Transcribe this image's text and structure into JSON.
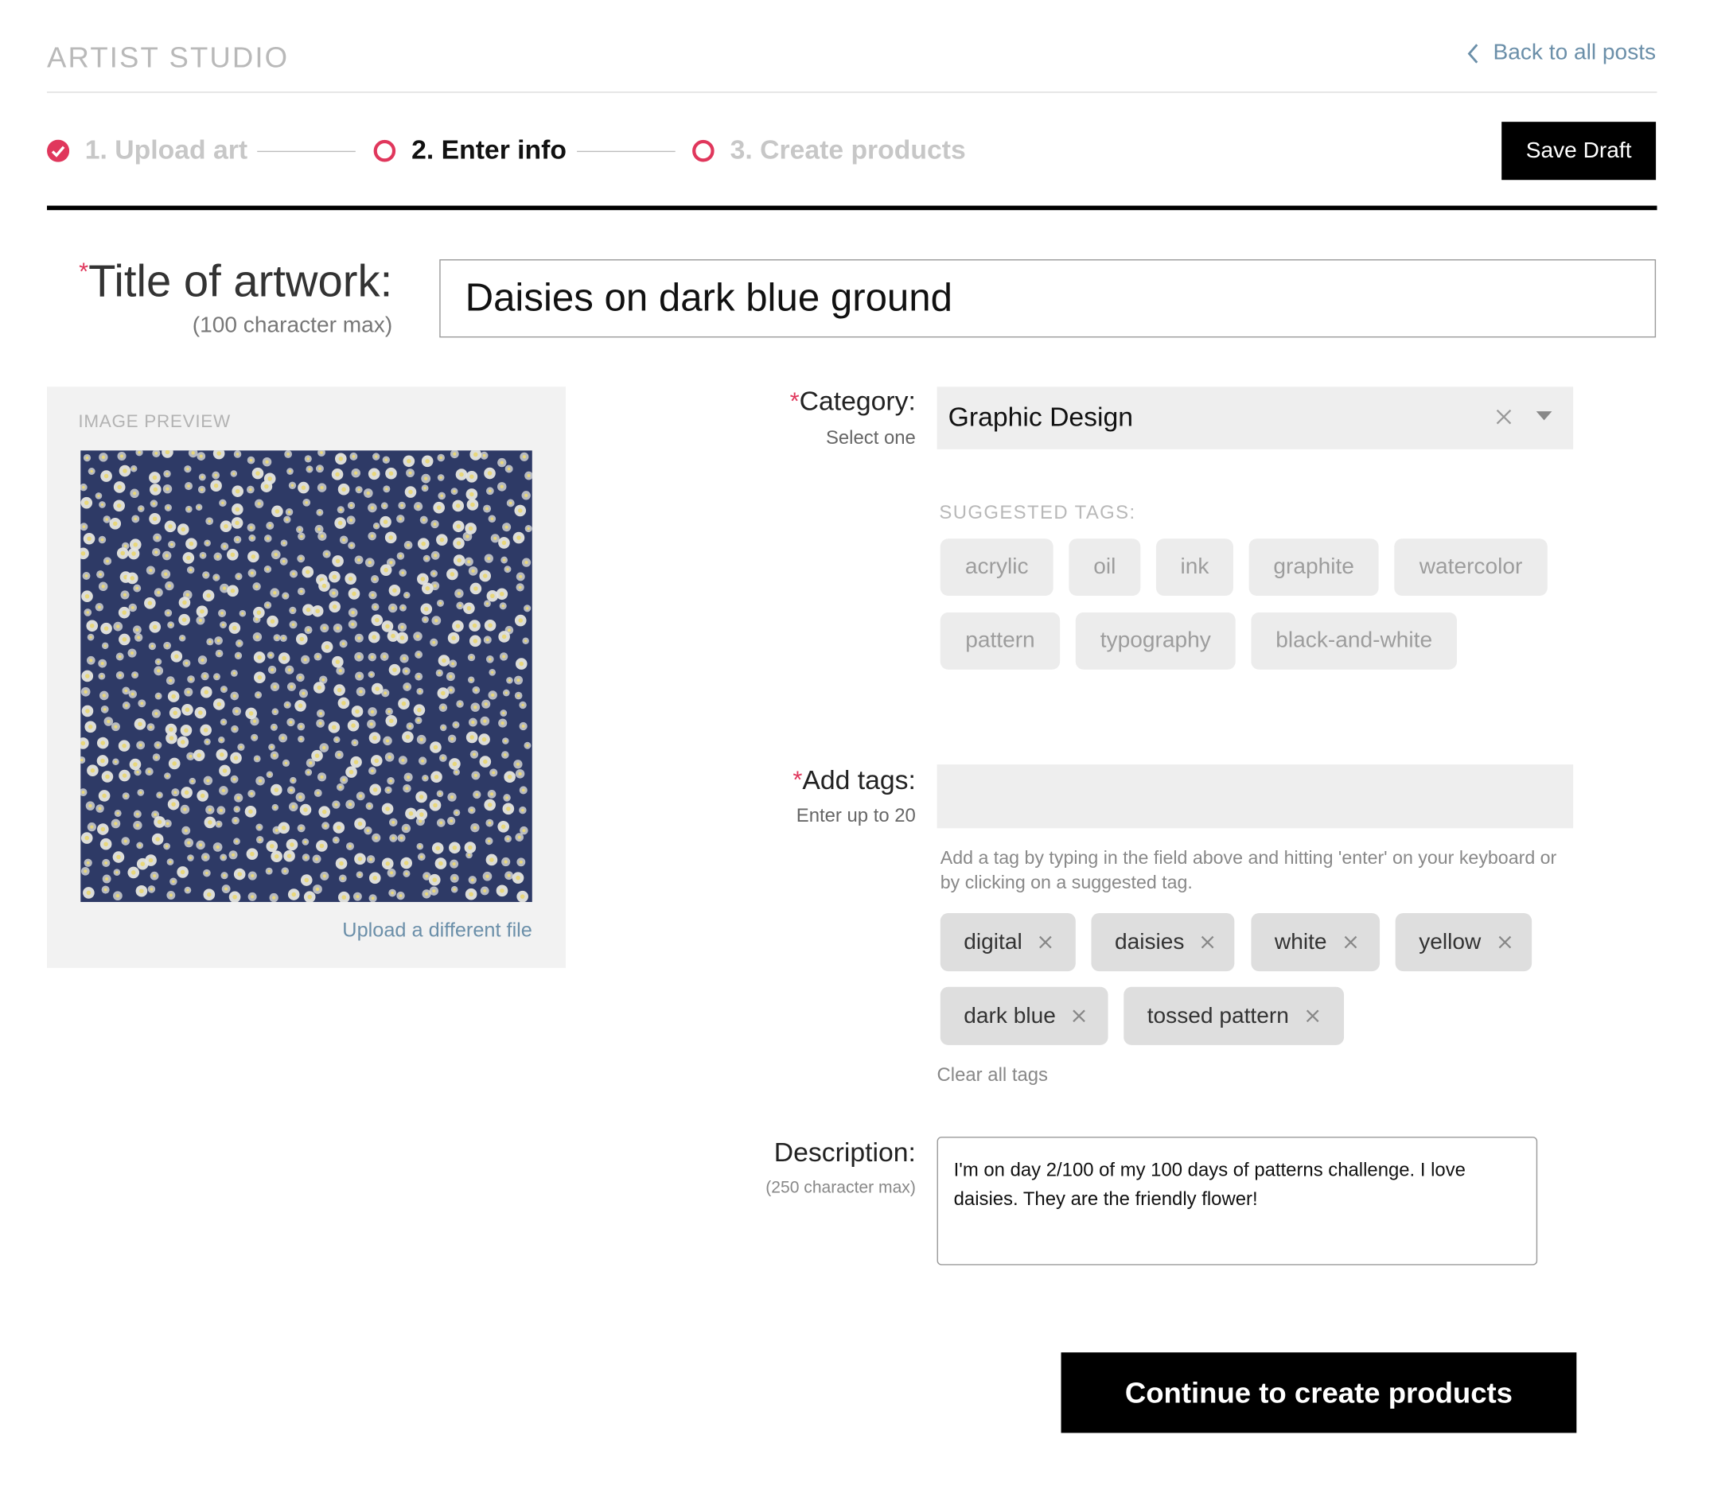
{
  "header": {
    "brand": "ARTIST STUDIO",
    "back_link": "Back to all posts"
  },
  "stepper": {
    "steps": [
      {
        "label": "1. Upload art",
        "status": "complete"
      },
      {
        "label": "2. Enter info",
        "status": "current"
      },
      {
        "label": "3. Create products",
        "status": "upcoming"
      }
    ],
    "save_draft": "Save Draft"
  },
  "title_field": {
    "required_mark": "*",
    "label": "Title of artwork:",
    "hint": "(100 character max)",
    "value": "Daisies on dark blue ground"
  },
  "preview": {
    "label": "IMAGE PREVIEW",
    "upload_link": "Upload a different file"
  },
  "category": {
    "required_mark": "*",
    "label": "Category:",
    "hint": "Select one",
    "value": "Graphic Design"
  },
  "suggested": {
    "label": "SUGGESTED TAGS:",
    "tags": [
      "acrylic",
      "oil",
      "ink",
      "graphite",
      "watercolor",
      "pattern",
      "typography",
      "black-and-white"
    ]
  },
  "tags": {
    "required_mark": "*",
    "label": "Add tags:",
    "hint": "Enter up to 20",
    "input_value": "",
    "help": "Add a tag by typing in the field above and hitting 'enter' on your keyboard or by clicking on a suggested tag.",
    "items": [
      "digital",
      "daisies",
      "white",
      "yellow",
      "dark blue",
      "tossed pattern"
    ],
    "clear_all": "Clear all tags"
  },
  "description": {
    "label": "Description:",
    "hint": "(250 character max)",
    "value": "I'm on day 2/100 of my 100 days of patterns challenge. I love daisies. They are the friendly flower!"
  },
  "actions": {
    "continue": "Continue to create products"
  },
  "colors": {
    "accent": "#e0375c",
    "link": "#6b8fa9",
    "pattern_ground": "#2e3a66",
    "daisy_petal": "#e6e6e0",
    "daisy_center": "#e8d77a"
  }
}
